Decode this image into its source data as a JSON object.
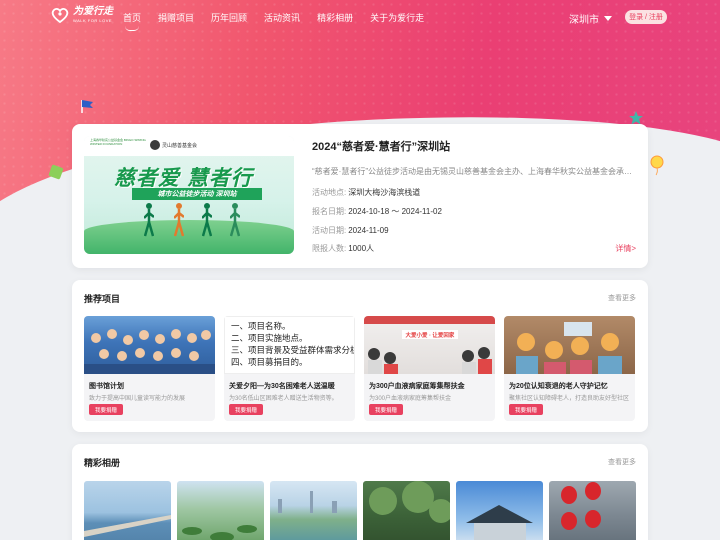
{
  "nav": {
    "logo_name": "为爱行走",
    "logo_sub": "WALK FOR LOVE",
    "menu": [
      {
        "label": "首页",
        "active": true
      },
      {
        "label": "捐赠项目"
      },
      {
        "label": "历年回顾"
      },
      {
        "label": "活动资讯"
      },
      {
        "label": "精彩相册"
      },
      {
        "label": "关于为爱行走"
      }
    ],
    "city": "深圳市",
    "login": "登录 / 注册"
  },
  "feature": {
    "poster": {
      "org_left": "上海春华秋实公益基金会 BINGO SPRING WINTER FOUNDATION",
      "org_right": "灵山慈善基金会",
      "headline": "慈者爱 慧者行",
      "band": "城市公益徒步活动 深圳站"
    },
    "title": "2024“慈者爱·慧者行”深圳站",
    "desc": "“慈者爱·慧者行”公益徒步活动是由无锡灵山慈善基金会主办、上海春华秋实公益基金会承办的城市公益徒步活动",
    "location_label": "活动地点:",
    "location": "深圳大梅沙海滨栈道",
    "signup_label": "报名日期:",
    "signup": "2024-10-18 ～ 2024-11-02",
    "date_label": "活动日期:",
    "date": "2024-11-09",
    "limit_label": "限报人数:",
    "limit": "1000人",
    "more": "详情>"
  },
  "projects": {
    "title": "推荐项目",
    "more": "查看更多",
    "items": [
      {
        "title": "图书馆计划",
        "desc": "致力于提高中国儿童读写能力的发展",
        "button": "我要捐赠"
      },
      {
        "title": "关爱夕阳—为30名困难老人送温暖",
        "desc": "为30名低山区困难老人赠送生活物资等。",
        "button": "我要捐赠"
      },
      {
        "title": "为300户血液病家庭筹集帮扶金",
        "desc": "为300户血液病家庭筹集帮扶金",
        "button": "我要捐赠"
      },
      {
        "title": "为20位认知衰退的老人守护记忆",
        "desc": "聚焦社区认知障碍老人，打造良助友好型社区",
        "button": "我要捐赠"
      }
    ],
    "img2_lines": [
      "一、项目名称。",
      "二、项目实施地点。",
      "三、项目背景及受益群体需求分析",
      "四、项目募捐目的。"
    ],
    "img3_banner": "大爱小爱 · 让爱回家"
  },
  "album": {
    "title": "精彩相册",
    "more": "查看更多"
  },
  "colors": {
    "accent": "#e8415f",
    "hero_start": "#f77a86",
    "hero_end": "#e8447e"
  }
}
